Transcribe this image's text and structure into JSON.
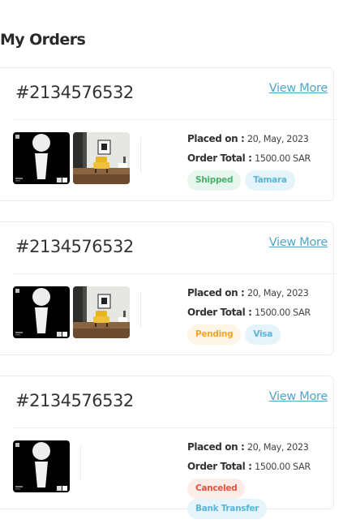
{
  "page": {
    "title": "My Orders"
  },
  "orders": [
    {
      "id": "#2134576532",
      "view_more": "View More",
      "placed_label": "Placed on :",
      "placed_value": "20, May, 2023",
      "total_label": "Order Total :",
      "total_value": "1500.00 SAR",
      "images": [
        "lamp-product-image",
        "chair-room-image"
      ],
      "status": {
        "label": "Shipped",
        "color": "#4caf6e",
        "bg": "#e7f6ec"
      },
      "payment": {
        "label": "Tamara",
        "color": "#5ab5d6",
        "bg": "#e4f4fa"
      }
    },
    {
      "id": "#2134576532",
      "view_more": "View More",
      "placed_label": "Placed on :",
      "placed_value": "20, May, 2023",
      "total_label": "Order Total :",
      "total_value": "1500.00 SAR",
      "images": [
        "lamp-product-image",
        "chair-room-image"
      ],
      "status": {
        "label": "Pending",
        "color": "#f3a426",
        "bg": "#fdf5e5"
      },
      "payment": {
        "label": "Visa",
        "color": "#5ab5d6",
        "bg": "#e4f4fa"
      }
    },
    {
      "id": "#2134576532",
      "view_more": "View More",
      "placed_label": "Placed on :",
      "placed_value": "20, May, 2023",
      "total_label": "Order Total :",
      "total_value": "1500.00 SAR",
      "images": [
        "lamp-product-image"
      ],
      "status": {
        "label": "Canceled",
        "color": "#e8503a",
        "bg": "#fdece8"
      },
      "payment": {
        "label": "Bank Transfer",
        "color": "#5ab5d6",
        "bg": "#e4f4fa"
      }
    }
  ]
}
